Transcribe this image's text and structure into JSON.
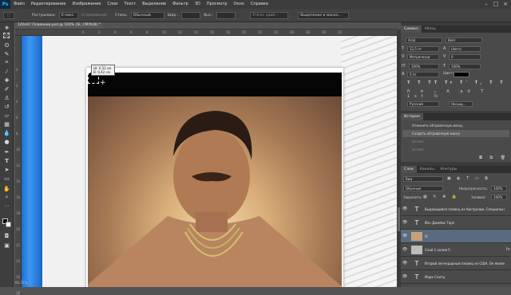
{
  "app": {
    "logo": "Ps"
  },
  "menu": [
    "Файл",
    "Редактирование",
    "Изображение",
    "Слои",
    "Текст",
    "Выделение",
    "Фильтр",
    "3D",
    "Просмотр",
    "Окно",
    "Справка"
  ],
  "window_controls": [
    "–",
    "□",
    "×"
  ],
  "options": {
    "feather_label": "Растушевка:",
    "feather_value": "0 пикс.",
    "antialias_label": "Сглаживание",
    "style_label": "Стиль:",
    "style_value": "Обычный",
    "width_label": "Шир.:",
    "height_label": "Выс.:",
    "refine_button": "Уточн. край...",
    "mask_button": "Выделение и маска..."
  },
  "document": {
    "tab_title": "140x97 Плавание.psd @ 100% (Sl, CMYK/8) *",
    "zoom_status": "66,72%"
  },
  "ruler_ticks": [
    "0",
    "2",
    "4",
    "6",
    "8",
    "10",
    "12",
    "14",
    "16",
    "18",
    "20",
    "22",
    "24",
    "26",
    "28",
    "30",
    "32"
  ],
  "measure_tooltip": {
    "w": "Ш: 0,52 см",
    "h": "В: 0,42 см"
  },
  "character_panel": {
    "tabs": [
      "Символ",
      "Абзац"
    ],
    "font_family": "Arial",
    "font_style": "Bold",
    "font_size": "12,5 пт",
    "leading": "(Авто)",
    "kerning": "Метрически",
    "tracking": "0",
    "vscale": "100%",
    "hscale": "100%",
    "baseline": "0 пт",
    "color_label": "Цвет:",
    "language": "Русский",
    "aa": "Насыщ..."
  },
  "history_panel": {
    "title": "История",
    "items": [
      {
        "label": "Отменить обтравочную маску",
        "state": "normal"
      },
      {
        "label": "Создать обтравочную маску",
        "state": "selected"
      },
      {
        "label": "Штамп",
        "state": "dim"
      },
      {
        "label": "Штамп",
        "state": "dim"
      }
    ]
  },
  "layers_panel": {
    "tabs": [
      "Слои",
      "Каналы",
      "Контуры"
    ],
    "kind_filter": "Вид",
    "blend_mode": "Обычные",
    "opacity_label": "Непрозрачность:",
    "opacity_value": "100%",
    "lock_label": "Закрепить:",
    "fill_label": "Заливка:",
    "fill_value": "100%",
    "layers": [
      {
        "name": "Выдающийся пловец из Австралии. Специально ...",
        "kind": "text",
        "selected": false,
        "link": false
      },
      {
        "name": "Йэн Джеймс Торп",
        "kind": "text",
        "selected": false,
        "link": false
      },
      {
        "name": "Sl",
        "kind": "image",
        "selected": true,
        "link": false
      },
      {
        "name": "Слой 1 копия 5",
        "kind": "image",
        "selected": false,
        "link": true
      },
      {
        "name": "Второй легендарный пловец из США. Он являе...",
        "kind": "text",
        "selected": false,
        "link": false
      },
      {
        "name": "Марк Спитц",
        "kind": "text",
        "selected": false,
        "link": false
      }
    ]
  },
  "colors": {
    "accent": "#31a8ff",
    "canvas_blue": "#3d97f2"
  }
}
